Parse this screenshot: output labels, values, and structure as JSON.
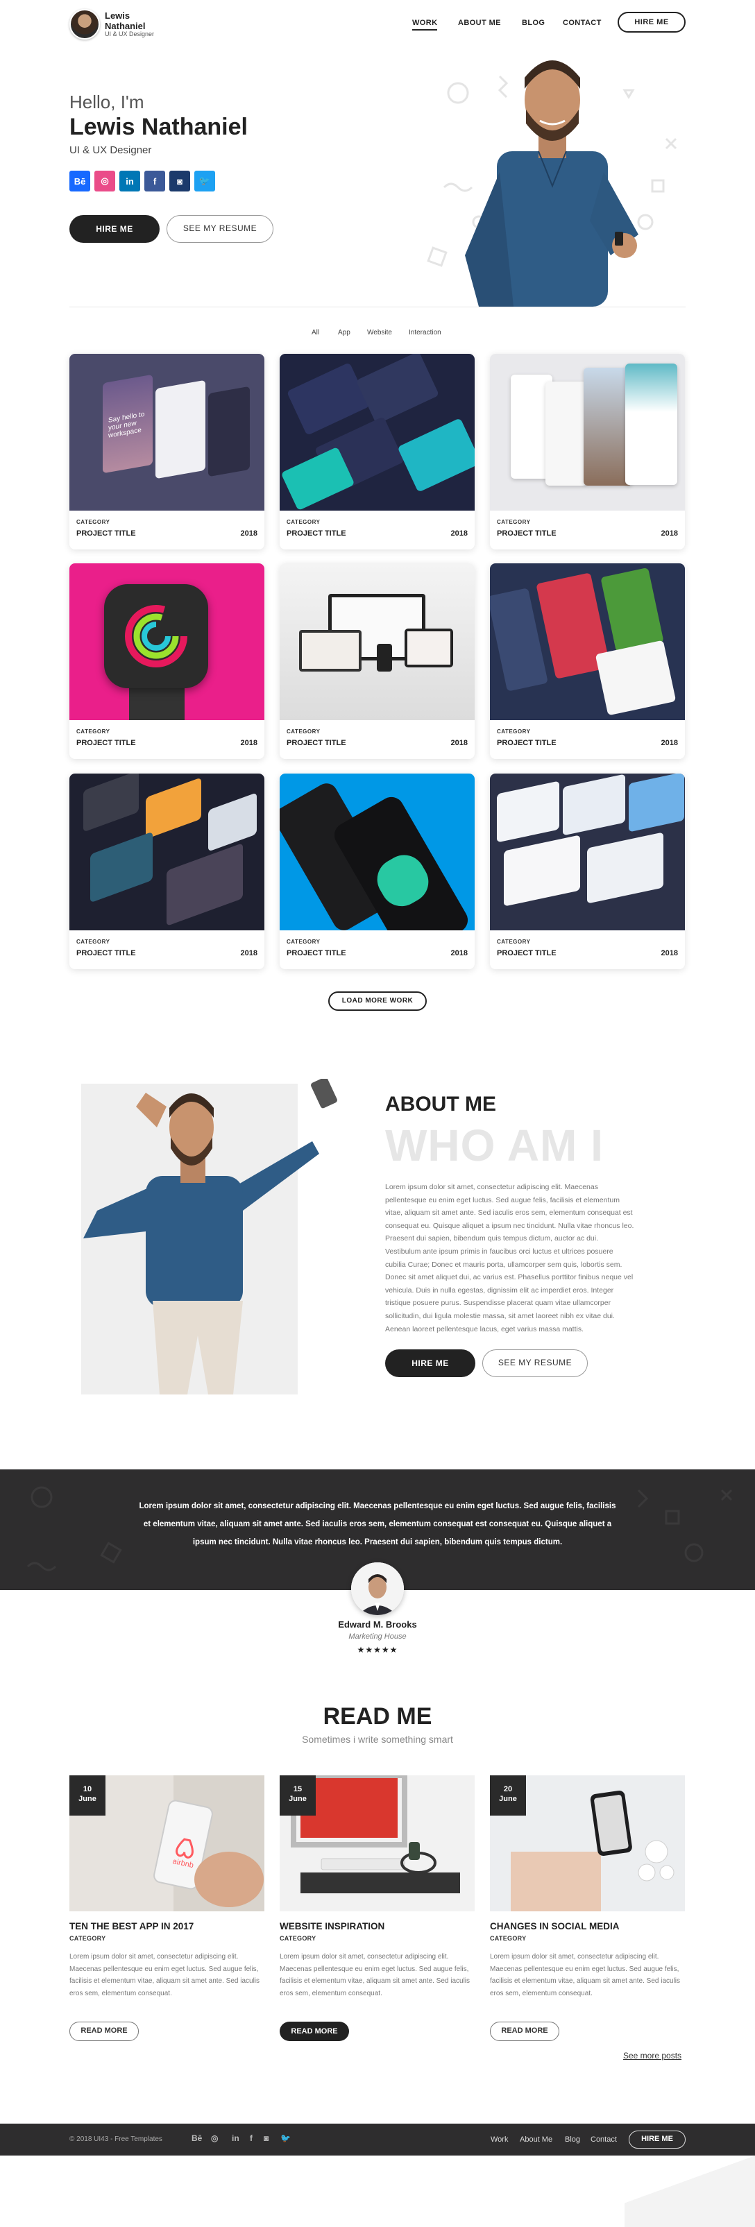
{
  "header": {
    "name": "Lewis Nathaniel",
    "role": "UI & UX Designer",
    "nav": [
      "WORK",
      "ABOUT ME",
      "BLOG",
      "CONTACT"
    ],
    "hire_btn": "HIRE ME"
  },
  "hero": {
    "greeting": "Hello, I'm",
    "name": "Lewis Nathaniel",
    "role": "UI & UX Designer",
    "social": [
      {
        "icon": "behance-icon",
        "glyph": "Bē",
        "color": "#1769ff"
      },
      {
        "icon": "dribbble-icon",
        "glyph": "◎",
        "color": "#ea4c89"
      },
      {
        "icon": "linkedin-icon",
        "glyph": "in",
        "color": "#0077b5"
      },
      {
        "icon": "facebook-icon",
        "glyph": "f",
        "color": "#3b5998"
      },
      {
        "icon": "instagram-icon",
        "glyph": "◙",
        "color": "#1b3a6b"
      },
      {
        "icon": "twitter-icon",
        "glyph": "🐦",
        "color": "#1da1f2"
      }
    ],
    "hire_btn": "HIRE ME",
    "resume_btn": "SEE MY RESUME"
  },
  "filters": [
    "All",
    "App",
    "Website",
    "Interaction"
  ],
  "projects": [
    {
      "category": "CATEGORY",
      "title": "PROJECT TITLE",
      "year": "2018"
    },
    {
      "category": "CATEGORY",
      "title": "PROJECT TITLE",
      "year": "2018"
    },
    {
      "category": "CATEGORY",
      "title": "PROJECT TITLE",
      "year": "2018"
    },
    {
      "category": "CATEGORY",
      "title": "PROJECT TITLE",
      "year": "2018"
    },
    {
      "category": "CATEGORY",
      "title": "PROJECT TITLE",
      "year": "2018"
    },
    {
      "category": "CATEGORY",
      "title": "PROJECT TITLE",
      "year": "2018"
    },
    {
      "category": "CATEGORY",
      "title": "PROJECT TITLE",
      "year": "2018"
    },
    {
      "category": "CATEGORY",
      "title": "PROJECT TITLE",
      "year": "2018"
    },
    {
      "category": "CATEGORY",
      "title": "PROJECT TITLE",
      "year": "2018"
    }
  ],
  "project_thumb_text": {
    "screen_hello": "Say hello to your new workspace"
  },
  "load_more": "LOAD MORE WORK",
  "about": {
    "heading": "ABOUT ME",
    "big": "WHO AM I",
    "text": "Lorem ipsum dolor sit amet, consectetur adipiscing elit. Maecenas pellentesque eu enim eget luctus. Sed augue felis, facilisis et elementum vitae, aliquam sit amet ante. Sed iaculis eros sem, elementum consequat est consequat eu. Quisque aliquet a ipsum nec tincidunt. Nulla vitae rhoncus leo. Praesent dui sapien, bibendum quis tempus dictum, auctor ac dui. Vestibulum ante ipsum primis in faucibus orci luctus et ultrices posuere cubilia Curae; Donec et mauris porta, ullamcorper sem quis, lobortis sem. Donec sit amet aliquet dui, ac varius est. Phasellus porttitor finibus neque vel vehicula. Duis in nulla egestas, dignissim elit ac imperdiet eros. Integer tristique posuere purus. Suspendisse placerat quam vitae ullamcorper sollicitudin, dui ligula molestie massa, sit amet laoreet nibh ex vitae dui. Aenean laoreet pellentesque lacus, eget varius massa mattis.",
    "hire_btn": "HIRE ME",
    "resume_btn": "SEE MY RESUME"
  },
  "testimonial": {
    "quote": "Lorem ipsum dolor sit amet, consectetur adipiscing elit. Maecenas pellentesque eu enim eget luctus. Sed augue felis, facilisis et elementum vitae, aliquam sit amet ante. Sed iaculis eros sem, elementum consequat est consequat eu. Quisque aliquet a ipsum nec tincidunt. Nulla vitae rhoncus leo. Praesent dui sapien, bibendum quis tempus dictum.",
    "name": "Edward M. Brooks",
    "role": "Marketing House",
    "stars": "★★★★★",
    "rating": 4.5
  },
  "blog": {
    "heading": "READ ME",
    "subheading": "Sometimes i write something smart",
    "posts": [
      {
        "day": "10",
        "month": "June",
        "title": "TEN THE BEST APP IN 2017",
        "category": "CATEGORY",
        "excerpt": "Lorem ipsum dolor sit amet, consectetur adipiscing elit. Maecenas pellentesque eu enim eget luctus. Sed augue felis, facilisis et elementum vitae, aliquam sit amet ante. Sed iaculis eros sem, elementum consequat.",
        "button": "READ MORE",
        "photo_brand": "airbnb"
      },
      {
        "day": "15",
        "month": "June",
        "title": "WEBSITE INSPIRATION",
        "category": "CATEGORY",
        "excerpt": "Lorem ipsum dolor sit amet, consectetur adipiscing elit. Maecenas pellentesque eu enim eget luctus. Sed augue felis, facilisis et elementum vitae, aliquam sit amet ante. Sed iaculis eros sem, elementum consequat.",
        "button": "READ MORE"
      },
      {
        "day": "20",
        "month": "June",
        "title": "CHANGES IN SOCIAL MEDIA",
        "category": "CATEGORY",
        "excerpt": "Lorem ipsum dolor sit amet, consectetur adipiscing elit. Maecenas pellentesque eu enim eget luctus. Sed augue felis, facilisis et elementum vitae, aliquam sit amet ante. Sed iaculis eros sem, elementum consequat.",
        "button": "READ MORE"
      }
    ],
    "see_more": "See more posts"
  },
  "footer": {
    "copyright": "© 2018 UI43 - Free Templates",
    "social_glyphs": [
      "Bē",
      "◎",
      "in",
      "f",
      "◙",
      "🐦"
    ],
    "nav": [
      "Work",
      "About Me",
      "Blog",
      "Contact"
    ],
    "hire_btn": "HIRE ME"
  },
  "colors": {
    "dark": "#222222",
    "band": "#2e2d2e",
    "accent_pink": "#ea1f8a",
    "accent_blue": "#0098e6"
  }
}
